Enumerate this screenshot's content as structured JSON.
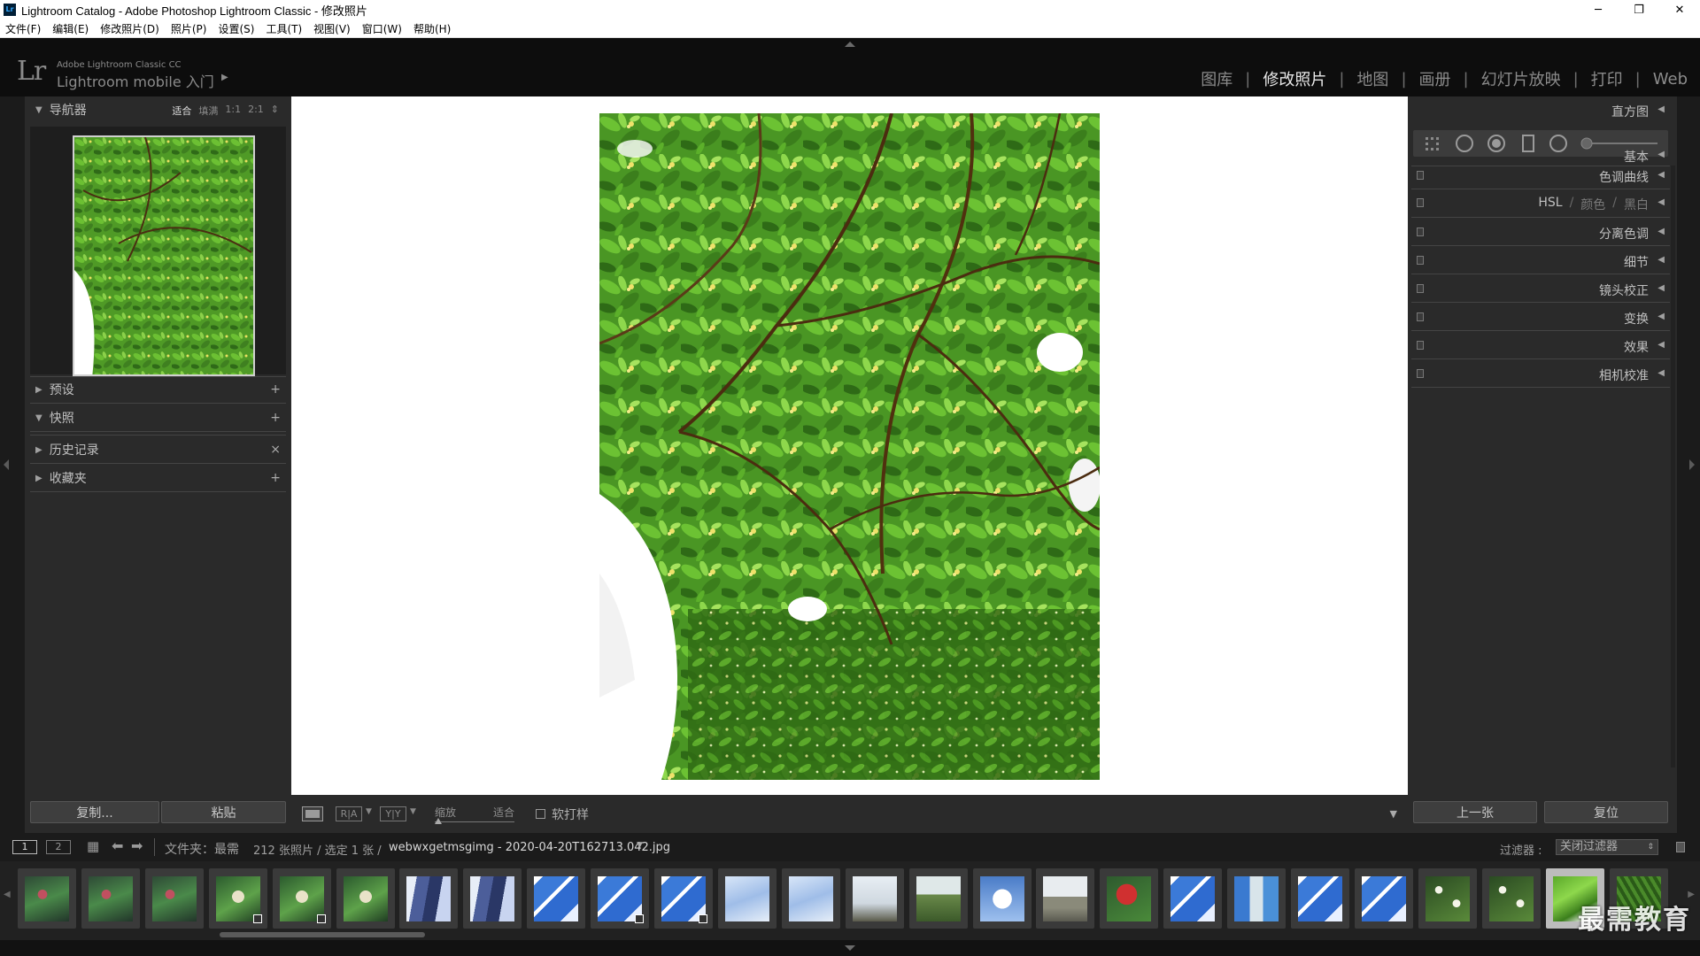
{
  "window": {
    "title": "Lightroom Catalog - Adobe Photoshop Lightroom Classic - 修改照片",
    "app_icon": "Lr",
    "controls": [
      "─",
      "❐",
      "✕"
    ]
  },
  "menu": [
    "文件(F)",
    "编辑(E)",
    "修改照片(D)",
    "照片(P)",
    "设置(S)",
    "工具(T)",
    "视图(V)",
    "窗口(W)",
    "帮助(H)"
  ],
  "identity": {
    "logo": "Lr",
    "product": "Adobe Lightroom Classic CC",
    "subtitle": "Lightroom mobile 入门",
    "arrow": "▶"
  },
  "modules": [
    {
      "label": "图库",
      "active": false
    },
    {
      "label": "修改照片",
      "active": true
    },
    {
      "label": "地图",
      "active": false
    },
    {
      "label": "画册",
      "active": false
    },
    {
      "label": "幻灯片放映",
      "active": false
    },
    {
      "label": "打印",
      "active": false
    },
    {
      "label": "Web",
      "active": false
    }
  ],
  "left_panel": {
    "navigator": {
      "title": "导航器",
      "opts": [
        "适合",
        "填满",
        "1:1",
        "2:1"
      ],
      "active_opt": "适合"
    },
    "sections": [
      {
        "title": "预设",
        "expanded": false,
        "action": "+"
      },
      {
        "title": "快照",
        "expanded": true,
        "action": "+"
      },
      {
        "title": "历史记录",
        "expanded": false,
        "action": "×"
      },
      {
        "title": "收藏夹",
        "expanded": false,
        "action": "+"
      }
    ],
    "copy_button": "复制...",
    "paste_button": "粘贴"
  },
  "toolbar": {
    "zoom_label": "缩放",
    "zoom_value": "适合",
    "softproof_label": "软打样",
    "ra_label": "R|A",
    "yy_label": "Y|Y"
  },
  "right_panel": {
    "histogram": "直方图",
    "panels": [
      "基本",
      "色调曲线",
      "分离色调",
      "细节",
      "镜头校正",
      "变换",
      "效果",
      "相机校准"
    ],
    "hsl": {
      "a": "HSL",
      "b": "颜色",
      "c": "黑白",
      "sep": "/"
    },
    "prev_button": "上一张",
    "reset_button": "复位"
  },
  "filmstrip": {
    "view1": "1",
    "view2": "2",
    "source_label": "文件夹：最需",
    "count_text": "212 张照片 / 选定 1 张 /",
    "filename": "webwxgetmsgimg - 2020-04-20T162713.042.jpg",
    "filter_label": "过滤器 :",
    "filter_value": "关闭过滤器",
    "thumbs": [
      {
        "kind": "plant-dark",
        "badge": false,
        "selected": false
      },
      {
        "kind": "plant-dark",
        "badge": false,
        "selected": false
      },
      {
        "kind": "plant-dark",
        "badge": false,
        "selected": false
      },
      {
        "kind": "plant",
        "badge": true,
        "selected": false
      },
      {
        "kind": "plant",
        "badge": true,
        "selected": false
      },
      {
        "kind": "plant",
        "badge": false,
        "selected": false
      },
      {
        "kind": "building",
        "badge": false,
        "selected": false
      },
      {
        "kind": "building",
        "badge": false,
        "selected": false
      },
      {
        "kind": "sky",
        "badge": false,
        "selected": false
      },
      {
        "kind": "sky",
        "badge": true,
        "selected": false
      },
      {
        "kind": "sky",
        "badge": true,
        "selected": false
      },
      {
        "kind": "sky-light",
        "badge": false,
        "selected": false
      },
      {
        "kind": "sky-light",
        "badge": false,
        "selected": false
      },
      {
        "kind": "tree-bare",
        "badge": false,
        "selected": false
      },
      {
        "kind": "tree-grass",
        "badge": false,
        "selected": false
      },
      {
        "kind": "cloud",
        "badge": false,
        "selected": false
      },
      {
        "kind": "street",
        "badge": false,
        "selected": false
      },
      {
        "kind": "red-leaf",
        "badge": false,
        "selected": false
      },
      {
        "kind": "sky",
        "badge": false,
        "selected": false
      },
      {
        "kind": "tower",
        "badge": false,
        "selected": false
      },
      {
        "kind": "sky",
        "badge": false,
        "selected": false
      },
      {
        "kind": "sky",
        "badge": false,
        "selected": false
      },
      {
        "kind": "flower-white",
        "badge": false,
        "selected": false
      },
      {
        "kind": "flower-white",
        "badge": false,
        "selected": false
      },
      {
        "kind": "leaves",
        "badge": false,
        "selected": true
      },
      {
        "kind": "fern",
        "badge": false,
        "selected": false
      }
    ]
  },
  "watermark": "最需教育",
  "colors": {
    "panel": "#2a2a2a",
    "leaf": "#5aa82a",
    "active_text": "#e8e8e8"
  }
}
